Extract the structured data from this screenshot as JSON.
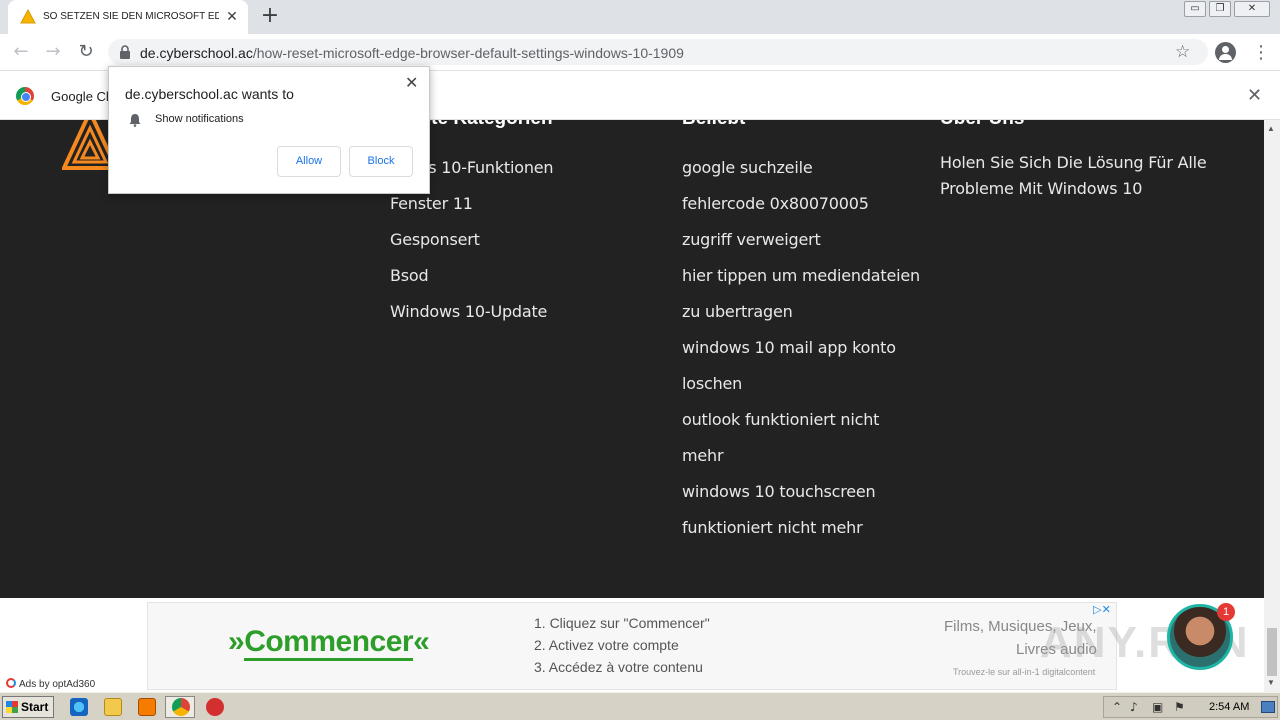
{
  "browser": {
    "tab_title": "SO SETZEN SIE DEN MICROSOFT ED",
    "new_tab_symbol": "+",
    "close_symbol": "✕",
    "url_host": "de.cyberschool.ac",
    "url_path": "/how-reset-microsoft-edge-browser-default-settings-windows-10-1909",
    "window_controls": [
      "▭",
      "❐",
      "✕"
    ]
  },
  "infobar": {
    "text": "Google Ch",
    "close_symbol": "✕"
  },
  "prompt": {
    "title": "de.cyberschool.ac wants to",
    "permission": "Show notifications",
    "allow_label": "Allow",
    "block_label": "Block",
    "close_symbol": "✕"
  },
  "footer": {
    "col1_heading": "…ebte Kategorien",
    "col1_links": [
      "…ows 10-Funktionen",
      "Fenster 11",
      "Gesponsert",
      "Bsod",
      "Windows 10-Update"
    ],
    "col2_heading": "Beliebt",
    "col2_links": [
      "google suchzeile",
      "fehlercode 0x80070005",
      "zugriff verweigert",
      "hier tippen um mediendateien",
      "zu ubertragen",
      "windows 10 mail app konto",
      "loschen",
      "outlook funktioniert nicht",
      "mehr",
      "windows 10 touchscreen",
      "funktioniert nicht mehr"
    ],
    "col3_heading": "Über Uns",
    "about_text": "Holen Sie Sich Die Lösung Für Alle Probleme Mit Windows 10"
  },
  "ad": {
    "ads_by": "Ads by optAd360",
    "cta_left": "»",
    "cta_word": "Commencer",
    "cta_right": "«",
    "steps": [
      "1. Cliquez sur \"Commencer\"",
      "2. Activez votre compte",
      "3. Accédez à votre contenu"
    ],
    "right_line1": "Films, Musiques, Jeux,",
    "right_line2": "Livres audio",
    "small_text": "Trouvez-le sur all-in-1 digitalcontent",
    "choices_label": "▷✕"
  },
  "overlay": {
    "badge_count": "1",
    "watermark": "ANY.RUN"
  },
  "taskbar": {
    "start_label": "Start",
    "clock": "2:54 AM"
  },
  "colors": {
    "page_bg": "#222222",
    "accent_orange": "#f5891f",
    "ad_green": "#2e9e2a",
    "link_blue": "#1a73e8"
  }
}
